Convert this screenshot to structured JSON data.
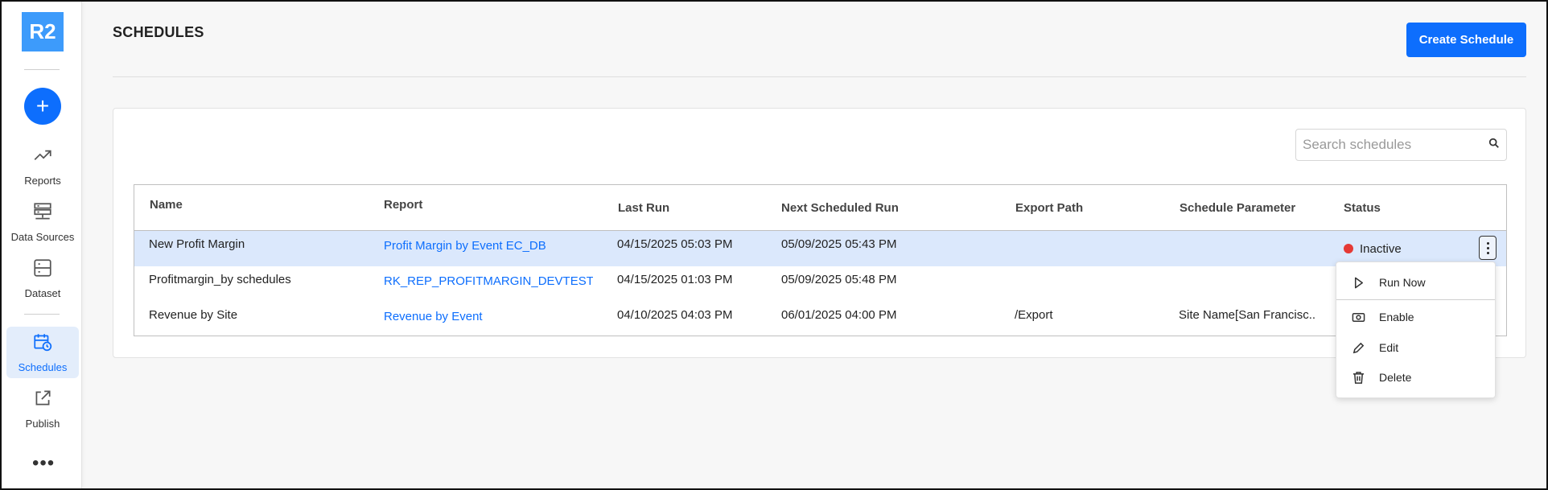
{
  "sidebar": {
    "logo": "R2",
    "add_symbol": "+",
    "items": [
      {
        "label": "Reports",
        "icon": "trend-icon"
      },
      {
        "label": "Data Sources",
        "icon": "server-icon"
      },
      {
        "label": "Dataset",
        "icon": "dataset-icon"
      },
      {
        "label": "Schedules",
        "icon": "calendar-clock-icon",
        "active": true
      },
      {
        "label": "Publish",
        "icon": "share-icon"
      }
    ],
    "more": "•••"
  },
  "header": {
    "title": "SCHEDULES",
    "create_button": "Create Schedule"
  },
  "search": {
    "placeholder": "Search schedules",
    "value": ""
  },
  "table": {
    "columns": [
      "Name",
      "Report",
      "Last Run",
      "Next Scheduled Run",
      "Export Path",
      "Schedule Parameter",
      "Status"
    ],
    "rows": [
      {
        "name": "New Profit Margin",
        "report": "Profit Margin by Event EC_DB",
        "last_run": "04/15/2025 05:03 PM",
        "next_run": "05/09/2025 05:43 PM",
        "export_path": "",
        "parameter": "",
        "status": "Inactive",
        "selected": true
      },
      {
        "name": "Profitmargin_by schedules",
        "report": "RK_REP_PROFITMARGIN_DEVTEST - ...",
        "last_run": "04/15/2025 01:03 PM",
        "next_run": "05/09/2025 05:48 PM",
        "export_path": "",
        "parameter": "",
        "status": ""
      },
      {
        "name": "Revenue by Site",
        "report": "Revenue by Event",
        "last_run": "04/10/2025 04:03 PM",
        "next_run": "06/01/2025 04:00 PM",
        "export_path": "/Export",
        "parameter": "Site Name[San Francisc...",
        "status": ""
      }
    ]
  },
  "context_menu": {
    "items": [
      {
        "label": "Run Now",
        "icon": "play-icon"
      },
      {
        "label": "Enable",
        "icon": "enable-icon"
      },
      {
        "label": "Edit",
        "icon": "pencil-icon"
      },
      {
        "label": "Delete",
        "icon": "trash-icon"
      }
    ]
  },
  "colors": {
    "primary": "#0d6efd",
    "logo": "#3d9bfb",
    "selected_row": "#dbe8fc",
    "status_inactive": "#e53935"
  }
}
